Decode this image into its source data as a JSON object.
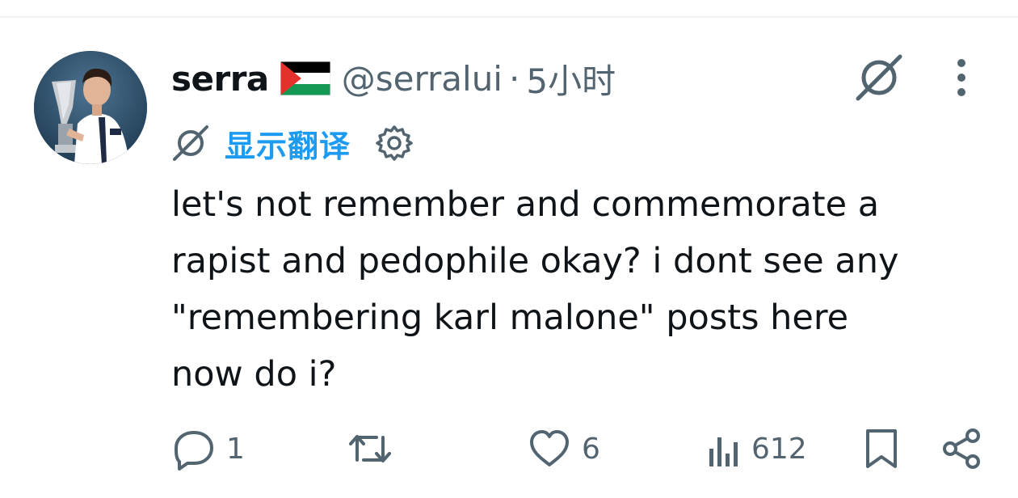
{
  "tweet": {
    "author": {
      "display_name": "serra",
      "flag_icon": "palestine-flag-icon",
      "handle": "@serralui",
      "separator": "·",
      "time": "5小时",
      "avatar_icon": "avatar-photo"
    },
    "translate": {
      "label": "显示翻译",
      "icon": "grok-icon",
      "settings_icon": "gear-icon"
    },
    "text_lines": [
      "let's not remember and commemorate a",
      "rapist and pedophile okay? i dont see any",
      "\"remembering karl malone\" posts here",
      "now do i?"
    ],
    "actions": {
      "reply": {
        "icon": "reply-icon",
        "count": "1"
      },
      "retweet": {
        "icon": "retweet-icon",
        "count": ""
      },
      "like": {
        "icon": "heart-icon",
        "count": "6"
      },
      "views": {
        "icon": "views-icon",
        "count": "612"
      },
      "bookmark": {
        "icon": "bookmark-icon"
      },
      "share": {
        "icon": "share-icon"
      }
    }
  },
  "colors": {
    "text": "#0f1419",
    "secondary": "#536471",
    "link": "#1d9bf0",
    "divider": "#eff3f4"
  }
}
